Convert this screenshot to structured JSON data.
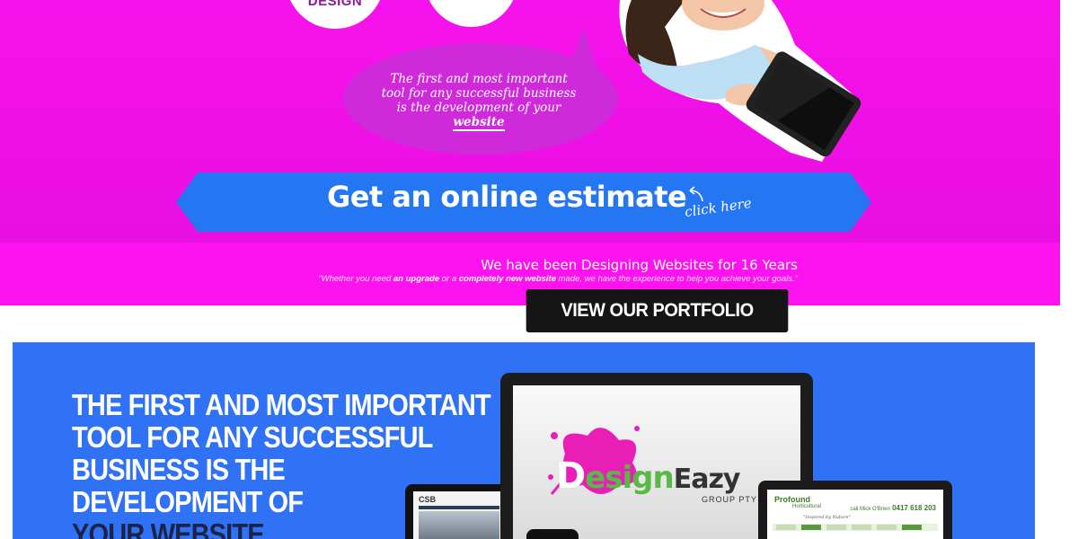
{
  "hero": {
    "circle_label": "DESIGN",
    "bubble_text_plain": "The first and most important tool for any successful business is the development of your",
    "bubble_text_emph": "website",
    "cta_label": "Get an online estimate",
    "click_here": "click here"
  },
  "experience": {
    "years_text": "We have been Designing Websites for 16 Years",
    "quote_part1": "\"Whether you need ",
    "quote_bold1": "an upgrade",
    "quote_part2": " or a ",
    "quote_bold2": "completely new website",
    "quote_part3": " made, we have the experience to help you achieve your goals.\"",
    "portfolio_button": "VIEW OUR PORTFOLIO"
  },
  "feature": {
    "headline_lines": [
      "THE FIRST AND MOST IMPORTANT",
      "TOOL FOR ANY SUCCESSFUL",
      "BUSINESS IS THE",
      "DEVELOPMENT OF",
      "YOUR WEBSITE"
    ],
    "monitor_logo": {
      "letter": "D",
      "word1": "esign",
      "word2": "Eazy",
      "sub": "GROUP PTY LTD"
    },
    "laptop_site": {
      "brand": "Profound",
      "brand_sub": "Horticultural",
      "phone_label": "call Mick O'Brien",
      "phone": "0417 618 203",
      "tagline": "\"Inspired by Nature\""
    },
    "tablet_site": {
      "logo": "CSB"
    }
  },
  "colors": {
    "magenta": "#ff12f0",
    "bubble": "#cf2ad9",
    "cta_blue": "#2576f2",
    "section_blue": "#2f72f5",
    "dark_button": "#151515"
  }
}
